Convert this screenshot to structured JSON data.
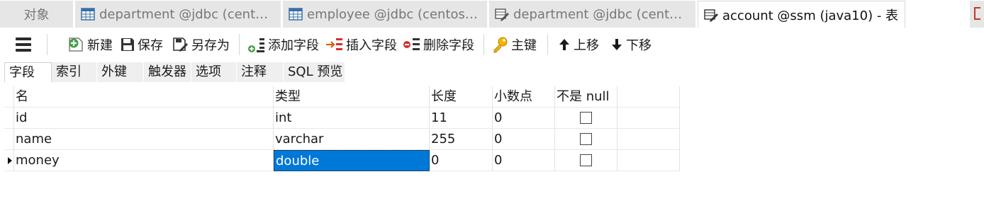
{
  "tabs": [
    {
      "label": "对象",
      "icon": "none",
      "active": false
    },
    {
      "label": "department @jdbc (centos)...",
      "icon": "table-icon",
      "active": false
    },
    {
      "label": "employee @jdbc (centos) - ...",
      "icon": "table-icon",
      "active": false
    },
    {
      "label": "department @jdbc (centos)...",
      "icon": "table-design-icon",
      "active": false
    },
    {
      "label": "account @ssm (java10) - 表",
      "icon": "table-design-icon",
      "active": true
    }
  ],
  "toolbar": {
    "new": "新建",
    "save": "保存",
    "save_as": "另存为",
    "add_field": "添加字段",
    "insert_field": "插入字段",
    "delete_field": "删除字段",
    "primary_key": "主键",
    "move_up": "上移",
    "move_down": "下移"
  },
  "subtabs": [
    "字段",
    "索引",
    "外键",
    "触发器",
    "选项",
    "注释",
    "SQL 预览"
  ],
  "grid": {
    "headers": {
      "name": "名",
      "type": "类型",
      "length": "长度",
      "decimals": "小数点",
      "not_null": "不是 null"
    },
    "rows": [
      {
        "name": "id",
        "type": "int",
        "length": "11",
        "decimals": "0",
        "not_null": false
      },
      {
        "name": "name",
        "type": "varchar",
        "length": "255",
        "decimals": "0",
        "not_null": false
      },
      {
        "name": "money",
        "type": "double",
        "length": "0",
        "decimals": "0",
        "not_null": false,
        "current": true,
        "selected_cell": "type"
      }
    ]
  },
  "colors": {
    "selection": "#0078d7",
    "tab_inactive": "#e6e6e6",
    "accent_green": "#4caf50",
    "accent_red": "#d32f2f"
  }
}
